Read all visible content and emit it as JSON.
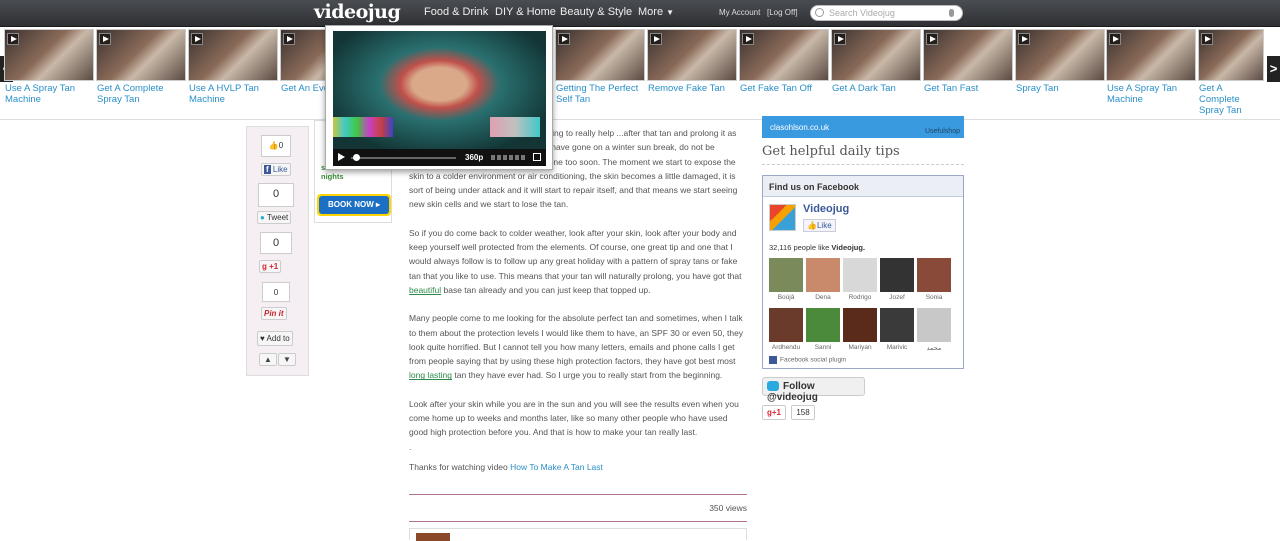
{
  "header": {
    "logo": "videojug",
    "nav": [
      "Food & Drink",
      "DIY & Home",
      "Beauty & Style",
      "More"
    ],
    "more_caret": "▼",
    "my_account": "My Account",
    "logoff": "[Log Off]",
    "search_placeholder": "Search Videojug"
  },
  "carousel": {
    "prev": "<",
    "next": ">",
    "items": [
      {
        "label": "Use A Spray Tan Machine"
      },
      {
        "label": "Get A Complete Spray Tan"
      },
      {
        "label": "Use A HVLP Tan Machine"
      },
      {
        "label": "Get An Eve"
      },
      {
        "label": "Getting The Perfect Self Tan"
      },
      {
        "label": "Remove Fake Tan"
      },
      {
        "label": "Get Fake Tan Off"
      },
      {
        "label": "Get A Dark Tan"
      },
      {
        "label": "Get Tan Fast"
      },
      {
        "label": "Spray Tan"
      },
      {
        "label": "Use A Spray Tan Machine"
      },
      {
        "label": "Get A Complete Spray Tan"
      }
    ]
  },
  "video": {
    "quality": "360p"
  },
  "share": {
    "fb_like_count": "0",
    "fb_like_label": "Like",
    "tweet_count": "0",
    "tweet_label": "Tweet",
    "gplus_count": "0",
    "gplus_label": "+1",
    "pin_count": "0",
    "pin_label": "Pin it",
    "add_to": "Add to"
  },
  "ad": {
    "text": "save £ u for 3 nights",
    "book": "BOOK NOW ▸"
  },
  "article": {
    "p1": "...orts of enzymes in there, that are going to really help ...after that tan and prolong it as long as possible. Also, ..., maybe you have gone on a winter sun break, do not be tempted to show off your tan to everyone too soon. The moment we start to expose the skin to a colder environment or air conditioning, the skin becomes a little damaged, it is sort of being under attack and it will start to repair itself, and that means we start seeing new skin cells and we start to lose the tan.",
    "p2a": "So if you do come back to colder weather, look after your skin, look after your body and keep yourself well protected from the elements. Of course, one great tip and one that I would always follow is to follow up any great holiday with a pattern of spray tans or fake tan that you like to use. This means that your tan will naturally prolong, you have got that ",
    "p2link": "beautiful",
    "p2b": " base tan already and you can just keep that topped up.",
    "p3a": "Many people come to me looking for the absolute perfect tan and sometimes, when I talk to them about the protection levels I would like them to have, an SPF 30 or even 50, they look quite horrified. But I cannot tell you how many letters, emails and phone calls I get from people saying that by using these high protection factors, they have got best most ",
    "p3link": "long lasting",
    "p3b": " tan they have ever had. So I urge you to really start from the beginning.",
    "p4": "Look after your skin while you are in the sun and you will see the results even when you come home up to weeks and months later, like so many other people who have used good high protection before you. And that is how to make your tan really last.",
    "dot": ".",
    "thanks": "Thanks for watching video ",
    "thanks_link": "How To Make A Tan Last",
    "views": "350 views"
  },
  "sidebar": {
    "banner_url": "clasohlson.co.uk",
    "banner_sub": "Usefulshop",
    "tips_title": "Get helpful daily tips",
    "fb_header": "Find us on Facebook",
    "fb_page": "Videojug",
    "fb_like": "Like",
    "fb_count_pre": "32,116 people like ",
    "fb_count_name": "Videojug.",
    "fans": [
      {
        "name": "Boùjâ",
        "color": "#7a8a5a"
      },
      {
        "name": "Dena",
        "color": "#c88a6a"
      },
      {
        "name": "Rodrigo",
        "color": "#d8d8d8"
      },
      {
        "name": "Jozef",
        "color": "#333333"
      },
      {
        "name": "Sonia",
        "color": "#8a4a3a"
      },
      {
        "name": "Ardhendu",
        "color": "#6a3a2a"
      },
      {
        "name": "Sanni",
        "color": "#4a8a3a"
      },
      {
        "name": "Mariyan",
        "color": "#5a2a1a"
      },
      {
        "name": "Marivic",
        "color": "#3a3a3a"
      },
      {
        "name": "محمد",
        "color": "#c8c8c8"
      }
    ],
    "fb_plugin": "Facebook social plugin",
    "follow": "Follow @videojug",
    "gplus": "+1",
    "gplus_count": "158"
  }
}
